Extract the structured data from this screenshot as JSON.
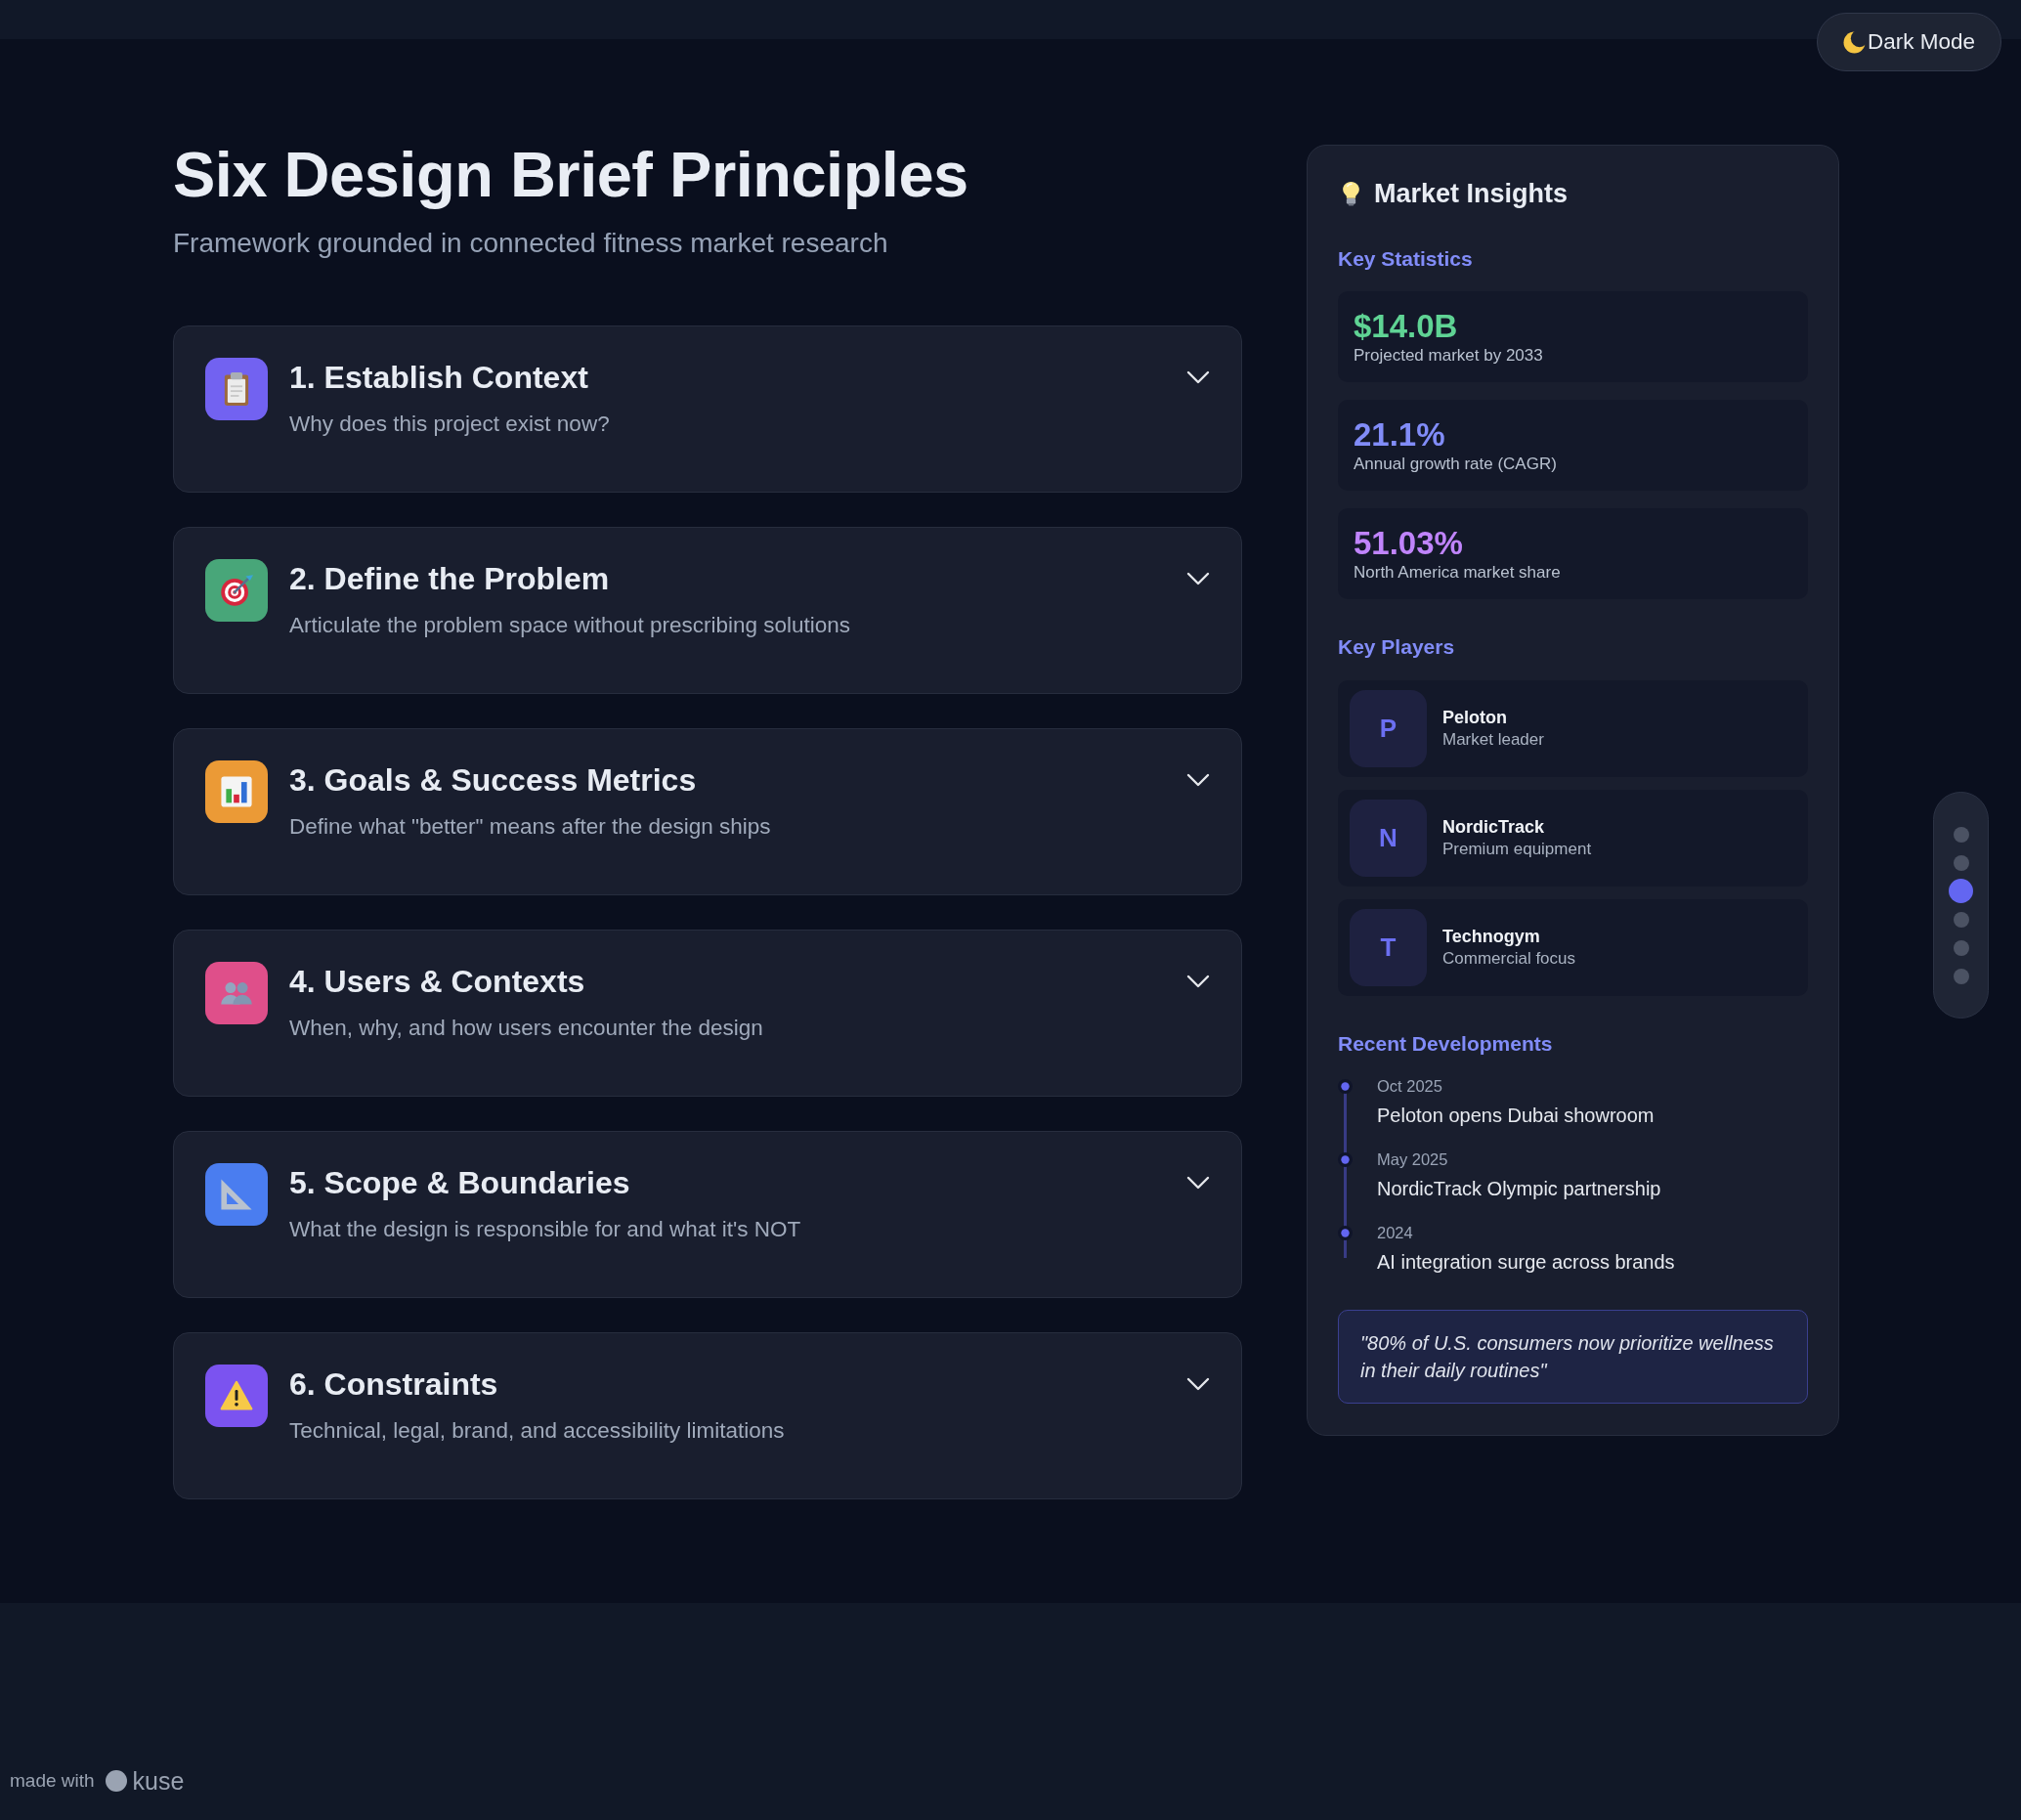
{
  "dark_mode_button": {
    "label": "Dark Mode"
  },
  "header": {
    "title": "Six Design Brief Principles",
    "subtitle": "Framework grounded in connected fitness market research"
  },
  "principles": [
    {
      "title": "1. Establish Context",
      "description": "Why does this project exist now?",
      "color": "#7262f1",
      "expanded": false
    },
    {
      "title": "2. Define the Problem",
      "description": "Articulate the problem space without prescribing solutions",
      "color": "#48a679",
      "expanded": false
    },
    {
      "title": "3. Goals & Success Metrics",
      "description": "Define what \"better\" means after the design ships",
      "color": "#eb9a36",
      "expanded": false
    },
    {
      "title": "4. Users & Contexts",
      "description": "When, why, and how users encounter the design",
      "color": "#df4f8a",
      "expanded": false
    },
    {
      "title": "5. Scope & Boundaries",
      "description": "What the design is responsible for and what it's NOT",
      "color": "#4a7df0",
      "expanded": false
    },
    {
      "title": "6. Constraints",
      "description": "Technical, legal, brand, and accessibility limitations",
      "color": "#7b53f0",
      "expanded": false
    }
  ],
  "market_insights": {
    "title": "Market Insights",
    "statistics_heading": "Key Statistics",
    "statistics": [
      {
        "value": "$14.0B",
        "label": "Projected market by 2033",
        "color": "#5fd394"
      },
      {
        "value": "21.1%",
        "label": "Annual growth rate (CAGR)",
        "color": "#818cf8"
      },
      {
        "value": "51.03%",
        "label": "North America market share",
        "color": "#c084fc"
      }
    ],
    "players_heading": "Key Players",
    "players": [
      {
        "initial": "P",
        "name": "Peloton",
        "description": "Market leader"
      },
      {
        "initial": "N",
        "name": "NordicTrack",
        "description": "Premium equipment"
      },
      {
        "initial": "T",
        "name": "Technogym",
        "description": "Commercial focus"
      }
    ],
    "developments_heading": "Recent Developments",
    "developments": [
      {
        "date": "Oct 2025",
        "text": "Peloton opens Dubai showroom"
      },
      {
        "date": "May 2025",
        "text": "NordicTrack Olympic partnership"
      },
      {
        "date": "2024",
        "text": "AI integration surge across brands"
      }
    ],
    "quote": "\"80% of U.S. consumers now prioritize wellness in their daily routines\""
  },
  "section_nav": [
    {
      "selected": false
    },
    {
      "selected": false
    },
    {
      "selected": true
    },
    {
      "selected": false
    },
    {
      "selected": false
    },
    {
      "selected": false
    }
  ],
  "footer": {
    "made_with": "made with",
    "brand": "kuse"
  }
}
